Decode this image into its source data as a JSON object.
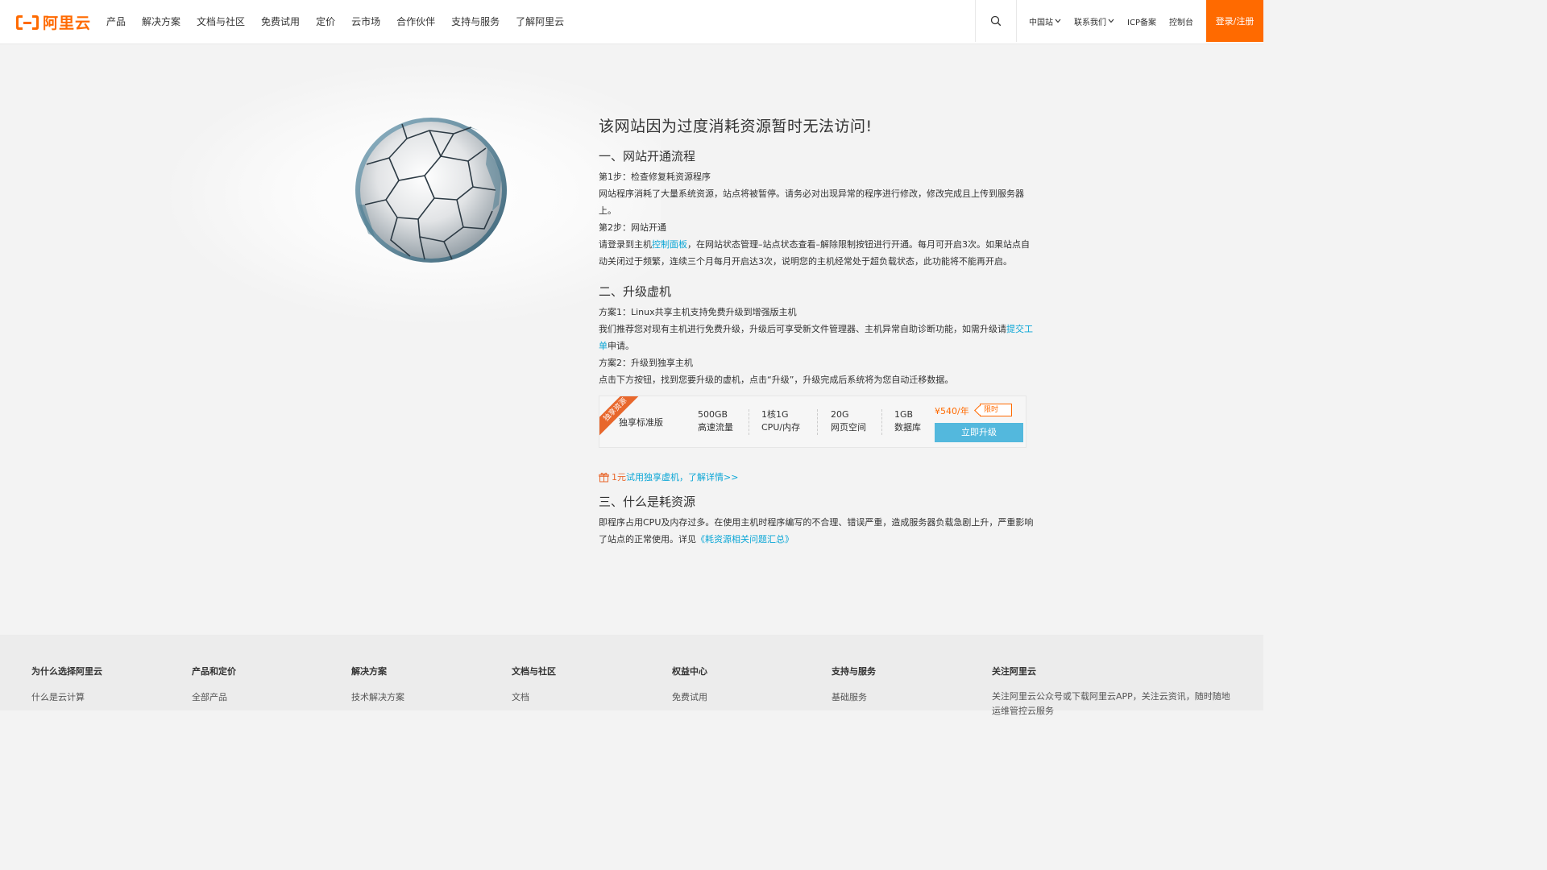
{
  "header": {
    "logo_text": "阿里云",
    "nav": [
      "产品",
      "解决方案",
      "文档与社区",
      "免费试用",
      "定价",
      "云市场",
      "合作伙伴",
      "支持与服务",
      "了解阿里云"
    ],
    "region": "中国站",
    "contact": "联系我们",
    "icp": "ICP备案",
    "console": "控制台",
    "login": "登录/注册"
  },
  "main": {
    "title": "该网站因为过度消耗资源暂时无法访问!",
    "s1_title": "一、网站开通流程",
    "s1_step1": "第1步：检查修复耗资源程序",
    "s1_step1_desc": "网站程序消耗了大量系统资源，站点将被暂停。请务必对出现异常的程序进行修改，修改完成且上传到服务器上。",
    "s1_step2": "第2步：网站开通",
    "s1_step2_pre": "请登录到主机",
    "s1_step2_link": "控制面板",
    "s1_step2_post": "，在网站状态管理–站点状态查看–解除限制按钮进行开通。每月可开启3次。如果站点自动关闭过于频繁，连续三个月每月开启达3次，说明您的主机经常处于超负载状态，此功能将不能再开启。",
    "s2_title": "二、升级虚机",
    "s2_plan1": "方案1：Linux共享主机支持免费升级到增强版主机",
    "s2_plan1_desc": "我们推荐您对现有主机进行免费升级，升级后可享受新文件管理器、主机异常自助诊断功能，如需升级请",
    "s2_plan1_link": "提交工单",
    "s2_plan1_post": "申请。",
    "s2_plan2": "方案2：升级到独享主机",
    "s2_plan2_desc": "点击下方按钮，找到您要升级的虚机，点击“升级”，升级完成后系统将为您自动迁移数据。",
    "plan": {
      "ribbon": "独享资源",
      "name": "独享标准版",
      "specs": [
        {
          "value": "500GB",
          "label": "高速流量"
        },
        {
          "value": "1核1G",
          "label": "CPU/内存"
        },
        {
          "value": "20G",
          "label": "网页空间"
        },
        {
          "value": "1GB",
          "label": "数据库"
        }
      ],
      "price": "¥540/年",
      "tag": "限时",
      "button": "立即升级"
    },
    "trial_red": "1元",
    "trial_link": "试用独享虚机，了解详情>>",
    "s3_title": "三、什么是耗资源",
    "s3_desc": "即程序占用CPU及内存过多。在使用主机时程序编写的不合理、错误严重，造成服务器负载急剧上升，严重影响了站点的正常使用。详见",
    "s3_link": "《耗资源相关问题汇总》"
  },
  "footer": {
    "cols": [
      {
        "title": "为什么选择阿里云",
        "item": "什么是云计算"
      },
      {
        "title": "产品和定价",
        "item": "全部产品"
      },
      {
        "title": "解决方案",
        "item": "技术解决方案"
      },
      {
        "title": "文档与社区",
        "item": "文档"
      },
      {
        "title": "权益中心",
        "item": "免费试用"
      },
      {
        "title": "支持与服务",
        "item": "基础服务"
      }
    ],
    "follow_title": "关注阿里云",
    "follow_text": "关注阿里云公众号或下载阿里云APP，关注云资讯，随时随地运维管控云服务"
  },
  "colors": {
    "brand": "#ff6a00",
    "link": "#0aa6d6",
    "button": "#53b8dd"
  }
}
